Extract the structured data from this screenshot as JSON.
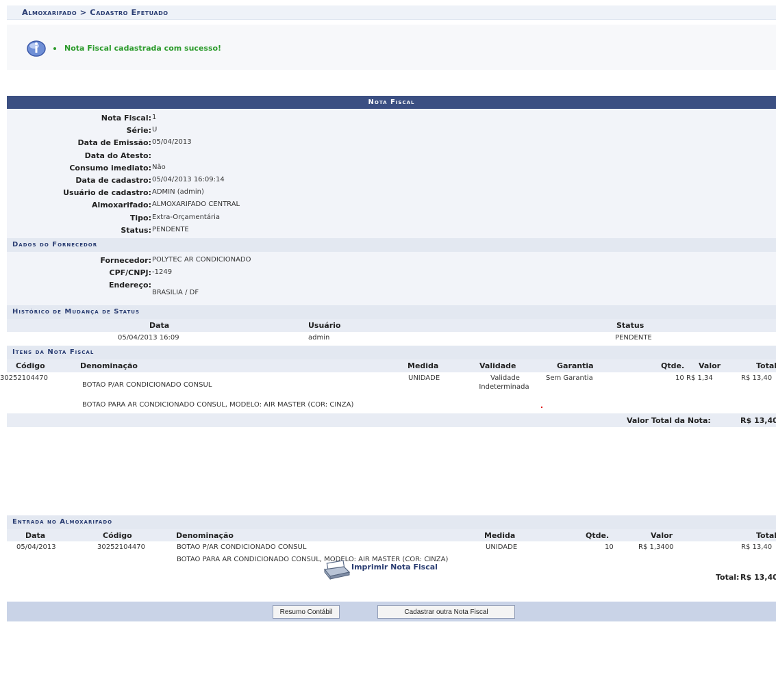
{
  "breadcrumb": "Almoxarifado > Cadastro Efetuado",
  "message": "Nota Fiscal cadastrada com sucesso!",
  "nota": {
    "caption": "Nota Fiscal",
    "fields": [
      {
        "label": "Nota Fiscal:",
        "value": "1"
      },
      {
        "label": "Série:",
        "value": "U"
      },
      {
        "label": "Data de Emissão:",
        "value": "05/04/2013"
      },
      {
        "label": "Data do Atesto:",
        "value": ""
      },
      {
        "label": "Consumo imediato:",
        "value": "Não"
      },
      {
        "label": "Data de cadastro:",
        "value": "05/04/2013 16:09:14"
      },
      {
        "label": "Usuário de cadastro:",
        "value": "ADMIN (admin)"
      },
      {
        "label": "Almoxarifado:",
        "value": "ALMOXARIFADO CENTRAL"
      },
      {
        "label": "Tipo:",
        "value": "Extra-Orçamentária"
      },
      {
        "label": "Status:",
        "value": "PENDENTE"
      }
    ]
  },
  "fornecedor": {
    "title": "Dados do Fornecedor",
    "fornecedor_label": "Fornecedor:",
    "fornecedor_value": "POLYTEC AR CONDICIONADO",
    "cnpj_label": "CPF/CNPJ:",
    "cnpj_value": "-1249",
    "endereco_label": "Endereço:",
    "endereco_value": "BRASILIA / DF"
  },
  "historico": {
    "title": "Histórico de Mudança de Status",
    "headers": {
      "data": "Data",
      "usuario": "Usuário",
      "status": "Status"
    },
    "row": {
      "data": "05/04/2013 16:09",
      "usuario": "admin",
      "status": "PENDENTE"
    }
  },
  "itens": {
    "title": "Itens da Nota Fiscal",
    "headers": {
      "codigo": "Código",
      "denominacao": "Denominação",
      "medida": "Medida",
      "validade": "Validade",
      "garantia": "Garantia",
      "qtde": "Qtde.",
      "valor": "Valor",
      "total": "Total"
    },
    "row": {
      "codigo": "30252104470",
      "denominacao": "BOTAO P/AR CONDICIONADO CONSUL",
      "medida": "UNIDADE",
      "validade1": "Validade",
      "validade2": "Indeterminada",
      "garantia": "Sem Garantia",
      "qtde": "10",
      "valor": "R$ 1,34",
      "total": "R$ 13,40"
    },
    "description": "BOTAO PARA AR CONDICIONADO CONSUL, MODELO: AIR MASTER (COR: CINZA)",
    "total_label": "Valor Total da Nota:",
    "total_value": "R$ 13,40"
  },
  "entrada": {
    "title": "Entrada no Almoxarifado",
    "headers": {
      "data": "Data",
      "codigo": "Código",
      "denominacao": "Denominação",
      "medida": "Medida",
      "qtde": "Qtde.",
      "valor": "Valor",
      "total": "Total"
    },
    "row": {
      "data": "05/04/2013",
      "codigo": "30252104470",
      "denominacao": "BOTAO P/AR CONDICIONADO CONSUL",
      "medida": "UNIDADE",
      "qtde": "10",
      "valor": "R$ 1,3400",
      "total": "R$ 13,40"
    },
    "description": "BOTAO PARA AR CONDICIONADO CONSUL, MODELO: AIR MASTER (COR: CINZA)",
    "total_label": "Total:",
    "total_value": "R$ 13,40"
  },
  "buttons": {
    "resumo": "Resumo Contábil",
    "cadastrar": "Cadastrar outra Nota Fiscal"
  },
  "print_link": "Imprimir Nota Fiscal"
}
